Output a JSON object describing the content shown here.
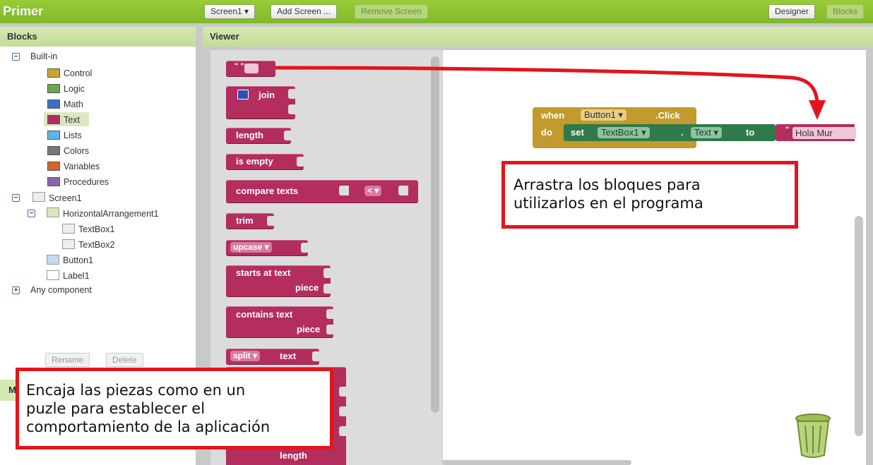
{
  "app": {
    "title": "Primer"
  },
  "toolbar": {
    "screen_select": "Screen1 ▾",
    "add_screen": "Add Screen ...",
    "remove_screen": "Remove Screen",
    "designer": "Designer",
    "blocks": "Blocks"
  },
  "blocks_panel": {
    "header": "Blocks",
    "builtin_label": "Built-in",
    "builtin_items": [
      {
        "label": "Control",
        "color": "#c9a52e"
      },
      {
        "label": "Logic",
        "color": "#6aa84f"
      },
      {
        "label": "Math",
        "color": "#3c6fc4"
      },
      {
        "label": "Text",
        "color": "#b32d5e"
      },
      {
        "label": "Lists",
        "color": "#5fb3e6"
      },
      {
        "label": "Colors",
        "color": "#777777"
      },
      {
        "label": "Variables",
        "color": "#d9622b"
      },
      {
        "label": "Procedures",
        "color": "#8a66a8"
      }
    ],
    "screen_label": "Screen1",
    "components": [
      "HorizontalArrangement1",
      "TextBox1",
      "TextBox2",
      "Button1",
      "Label1"
    ],
    "any_component": "Any component",
    "rename_button": "Rename",
    "delete_button": "Delete",
    "hidden_label_initial": "M"
  },
  "viewer": {
    "header": "Viewer",
    "drawer_blocks": {
      "text_literal": "\" \"",
      "join": "join",
      "length": "length",
      "is_empty": "is empty",
      "compare": "compare texts",
      "compare_op": "< ▾",
      "trim": "trim",
      "upcase": "upcase ▾",
      "starts_at_1": "starts at  text",
      "starts_at_2": "piece",
      "contains_1": "contains  text",
      "contains_2": "piece",
      "split": "split ▾",
      "split_text": "text",
      "length_bottom": "length"
    },
    "event_block": {
      "when": "when",
      "component": "Button1 ▾",
      "event": ".Click",
      "do": "do",
      "set": "set",
      "set_component": "TextBox1 ▾",
      "dot": ".",
      "property": "Text ▾",
      "to": "to",
      "value": "Hola Mur"
    }
  },
  "callouts": {
    "right": [
      "Arrastra los bloques para",
      "utilizarlos en el programa"
    ],
    "left": [
      "Encaja las piezas como en un",
      "puzle para establecer el",
      "comportamiento de la aplicación"
    ]
  },
  "colors": {
    "accent_green": "#8cc63f",
    "text_block": "#b32d5e",
    "callout_border": "#e3141b"
  }
}
